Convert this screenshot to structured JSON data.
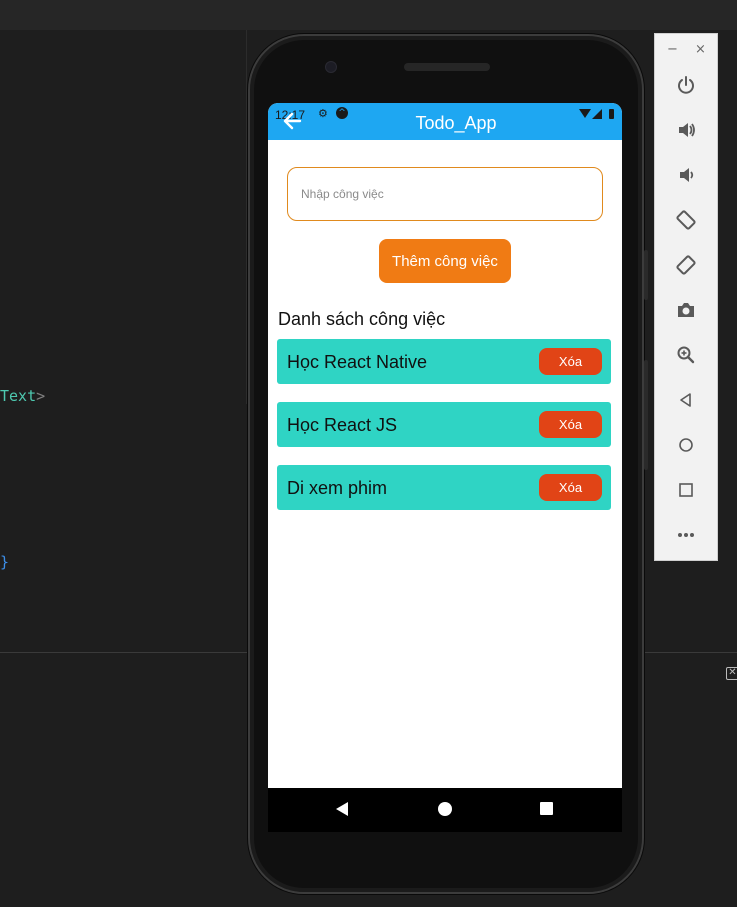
{
  "ide": {
    "code_tag_name": "Text",
    "code_tag_close": ">",
    "code_brace": "}"
  },
  "status_bar": {
    "time": "12:17"
  },
  "app_bar": {
    "title": "Todo_App"
  },
  "form": {
    "input_placeholder": "Nhập công việc",
    "input_value": "",
    "add_button_label": "Thêm công việc"
  },
  "list": {
    "heading": "Danh sách công việc",
    "items": [
      {
        "text": "Học React Native",
        "delete_label": "Xóa"
      },
      {
        "text": "Học React JS",
        "delete_label": "Xóa"
      },
      {
        "text": "Di xem phim",
        "delete_label": "Xóa"
      }
    ]
  },
  "emulator_toolbar": {
    "minimize": "−",
    "close": "×",
    "buttons": [
      "power-icon",
      "volume-up-icon",
      "volume-down-icon",
      "rotate-left-icon",
      "rotate-right-icon",
      "camera-icon",
      "zoom-icon",
      "back-icon",
      "home-icon",
      "overview-icon",
      "more-icon"
    ]
  },
  "colors": {
    "app_bar": "#1ea7f2",
    "add_button": "#f07b14",
    "input_border": "#e08a1e",
    "task_item": "#2fd4c4",
    "delete_button": "#e14416"
  }
}
